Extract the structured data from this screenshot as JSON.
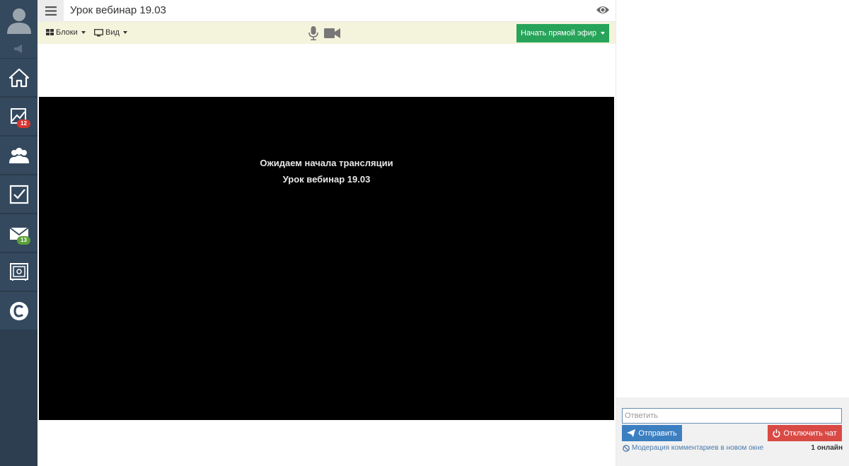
{
  "header": {
    "title": "Урок вебинар 19.03",
    "menu_icon": "hamburger-icon",
    "view_icon": "eye-icon"
  },
  "toolbar": {
    "blocks_label": "Блоки",
    "view_label": "Вид",
    "mic_icon": "microphone-icon",
    "camera_icon": "video-camera-icon",
    "start_live_label": "Начать прямой эфир"
  },
  "sidebar": {
    "items": [
      {
        "icon": "home-icon"
      },
      {
        "icon": "chart-icon",
        "badge": "12"
      },
      {
        "icon": "users-icon"
      },
      {
        "icon": "checkbox-icon"
      },
      {
        "icon": "mail-icon",
        "badge": "13"
      },
      {
        "icon": "safe-icon"
      },
      {
        "icon": "skype-icon"
      }
    ]
  },
  "video": {
    "line1": "Ожидаем начала трансляции",
    "line2": "Урок вебинар 19.03"
  },
  "chat": {
    "reply_placeholder": "Ответить",
    "send_label": "Отправить",
    "disable_label": "Отключить чат",
    "moderation_label": "Модерация комментариев в новом окне",
    "online_label": "1 онлайн"
  },
  "colors": {
    "sidebar_bg": "#34495e",
    "toolbar_bg": "#f4f3dc",
    "live_button": "#27a45a",
    "send_button": "#3c7fc1",
    "disable_button": "#d94a45"
  }
}
